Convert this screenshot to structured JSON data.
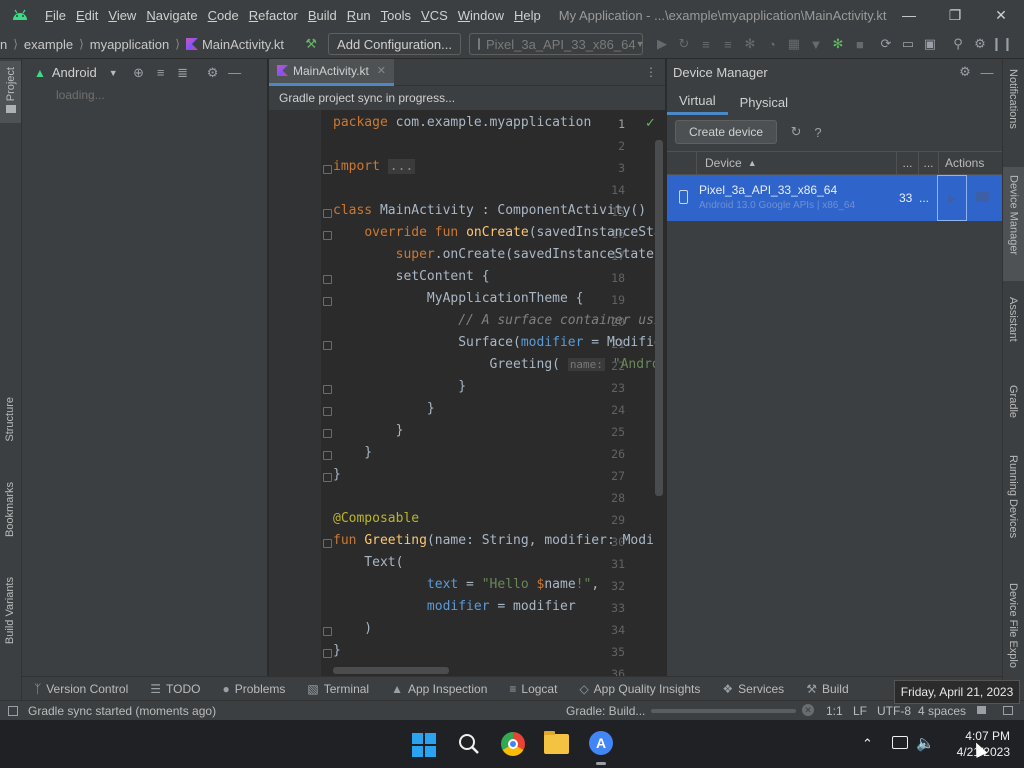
{
  "titlebar": {
    "menus": [
      {
        "label": "File",
        "mn": "F",
        "rest": "ile"
      },
      {
        "label": "Edit",
        "mn": "E",
        "rest": "dit"
      },
      {
        "label": "View",
        "mn": "V",
        "rest": "iew"
      },
      {
        "label": "Navigate",
        "mn": "N",
        "rest": "avigate"
      },
      {
        "label": "Code",
        "mn": "C",
        "rest": "ode"
      },
      {
        "label": "Refactor",
        "mn": "R",
        "rest": "efactor"
      },
      {
        "label": "Build",
        "mn": "B",
        "rest": "uild"
      },
      {
        "label": "Run",
        "mn": "R",
        "rest": "un"
      },
      {
        "label": "Tools",
        "mn": "T",
        "rest": "ools"
      },
      {
        "label": "VCS",
        "mn": "V",
        "rest": "CS"
      },
      {
        "label": "Window",
        "mn": "W",
        "rest": "indow"
      },
      {
        "label": "Help",
        "mn": "H",
        "rest": "elp"
      }
    ],
    "window_title": "My Application - ...\\example\\myapplication\\MainActivity.kt"
  },
  "navbar": {
    "crumb_lead": "n",
    "crumbs": [
      "example",
      "myapplication",
      "MainActivity.kt"
    ],
    "config_label": "Add Configuration...",
    "device_label": "Pixel_3a_API_33_x86_64"
  },
  "left_stripe": {
    "project": "Project",
    "structure": "Structure",
    "bookmarks": "Bookmarks",
    "build_variants": "Build Variants"
  },
  "project_panel": {
    "view": "Android",
    "loading": "loading..."
  },
  "editor": {
    "tab_label": "MainActivity.kt",
    "sync_banner": "Gradle project sync in progress...",
    "line_numbers": [
      "1",
      "2",
      "3",
      "14",
      "15",
      "16",
      "17",
      "18",
      "19",
      "20",
      "21",
      "22",
      "23",
      "24",
      "25",
      "26",
      "27",
      "28",
      "29",
      "30",
      "31",
      "32",
      "33",
      "34",
      "35",
      "36"
    ]
  },
  "device_manager": {
    "title": "Device Manager",
    "tabs": [
      "Virtual",
      "Physical"
    ],
    "create_label": "Create device",
    "col_device": "Device",
    "col_dots1": "...",
    "col_dots2": "...",
    "col_actions": "Actions",
    "device_name": "Pixel_3a_API_33_x86_64",
    "device_sub": "Android 13.0 Google APIs | x86_64",
    "device_api": "33",
    "device_more": "..."
  },
  "right_stripe": {
    "notifications": "Notifications",
    "device_manager": "Device Manager",
    "assistant": "Assistant",
    "gradle": "Gradle",
    "running_devices": "Running Devices",
    "device_file_explorer": "Device File Explo"
  },
  "tool_windows": [
    "Version Control",
    "TODO",
    "Problems",
    "Terminal",
    "App Inspection",
    "Logcat",
    "App Quality Insights",
    "Services",
    "Build"
  ],
  "statusbar": {
    "message": "Gradle sync started (moments ago)",
    "gradle_progress": "Gradle: Build...",
    "progress": 0.0,
    "caret": "1:1",
    "line_sep": "LF",
    "encoding": "UTF-8",
    "indent": "4 spaces"
  },
  "taskbar": {
    "time": "4:07 PM",
    "date": "4/21/2023",
    "tooltip": "Friday, April 21, 2023"
  },
  "colors": {
    "accent": "#4a88c7",
    "selection": "#2f65ca",
    "success": "#5fb85f"
  }
}
